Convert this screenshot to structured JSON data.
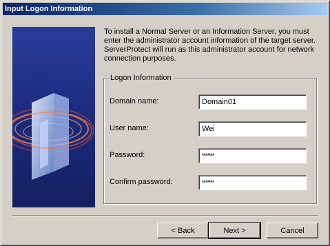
{
  "window": {
    "title": "Input Logon Information"
  },
  "intro_text": "To install a Normal Server or an Information Server, you must enter the administrator account information of the target server. ServerProtect will run as this administrator account for network connection purposes.",
  "group": {
    "legend": "Logon Information",
    "fields": [
      {
        "label": "Domain name:",
        "value": "Domain01"
      },
      {
        "label": "User name:",
        "value": "Wei"
      },
      {
        "label": "Password:",
        "value": "*******"
      },
      {
        "label": "Confirm password:",
        "value": "*******"
      }
    ]
  },
  "buttons": {
    "back": "< Back",
    "next": "Next >",
    "cancel": "Cancel"
  },
  "colors": {
    "titlebar_start": "#0a246a",
    "titlebar_end": "#a6caf0",
    "dialog_bg": "#d4d0c8"
  }
}
